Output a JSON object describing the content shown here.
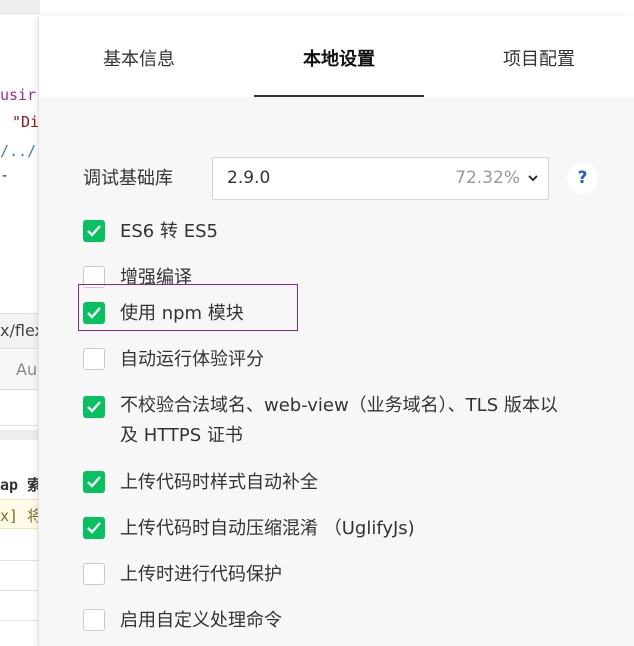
{
  "background_editor": {
    "code_lines": [
      "usir",
      "\"Di",
      "/../",
      "-"
    ],
    "path_text": "x/flex",
    "tab_text": "Au",
    "console_lines": [
      "ap 索",
      "x] 将"
    ]
  },
  "settings": {
    "tabs": [
      {
        "label": "基本信息",
        "active": false
      },
      {
        "label": "本地设置",
        "active": true
      },
      {
        "label": "项目配置",
        "active": false
      }
    ],
    "debug_lib": {
      "label": "调试基础库",
      "version": "2.9.0",
      "percent": "72.32%",
      "help": "?"
    },
    "options": [
      {
        "label": "ES6 转 ES5",
        "checked": true
      },
      {
        "label": "增强编译",
        "checked": false
      },
      {
        "label": "使用 npm 模块",
        "checked": true
      },
      {
        "label": "自动运行体验评分",
        "checked": false
      },
      {
        "label": "不校验合法域名、web-view（业务域名）、TLS 版本以及 HTTPS 证书",
        "checked": true
      },
      {
        "label": "上传代码时样式自动补全",
        "checked": true
      },
      {
        "label": "上传代码时自动压缩混淆 （UglifyJs)",
        "checked": true
      },
      {
        "label": "上传时进行代码保护",
        "checked": false
      },
      {
        "label": "启用自定义处理命令",
        "checked": false
      }
    ]
  },
  "colors": {
    "checkbox_checked": "#07c160",
    "highlight_border": "#7b2c8e",
    "help_icon": "#1e5bd7"
  }
}
